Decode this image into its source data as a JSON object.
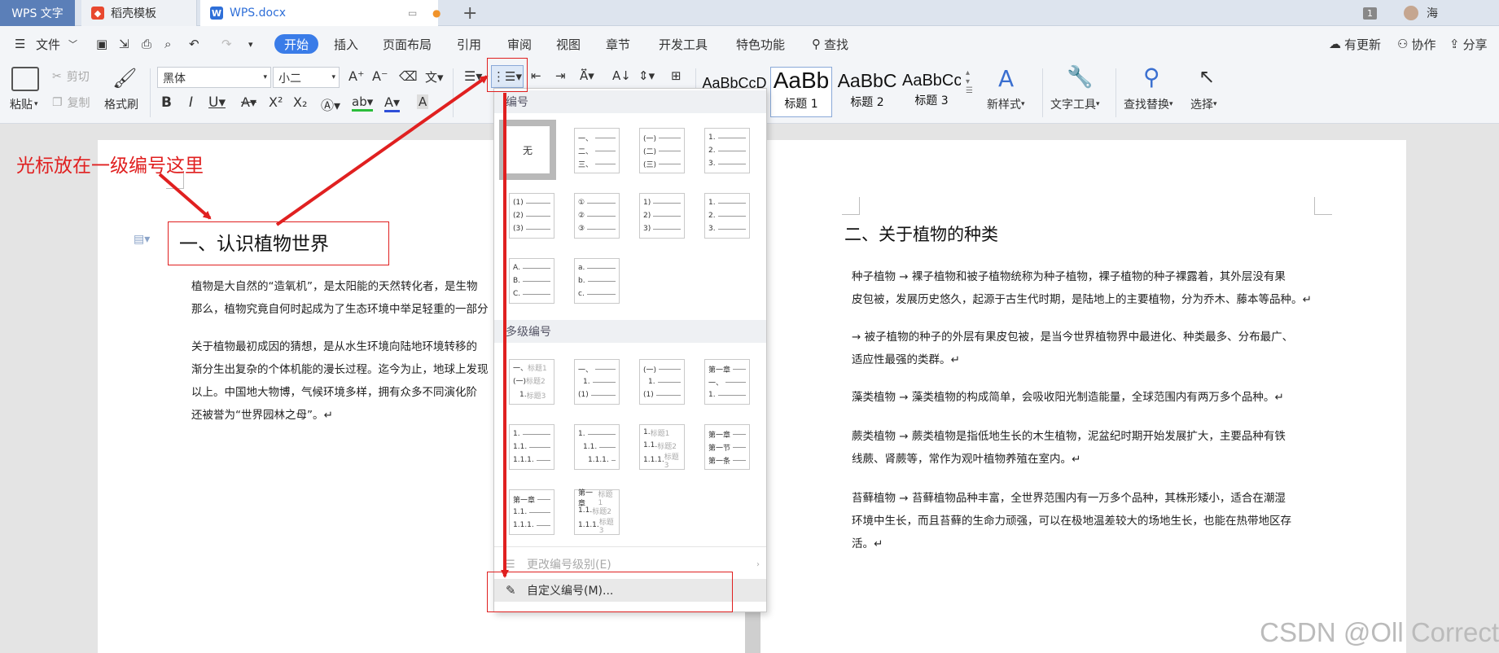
{
  "tabs": {
    "app": "WPS 文字",
    "template": "稻壳模板",
    "document": "WPS.docx",
    "page_badge": "1",
    "user": "海"
  },
  "menu": {
    "file": "文件",
    "items": [
      "开始",
      "插入",
      "页面布局",
      "引用",
      "审阅",
      "视图",
      "章节",
      "开发工具",
      "特色功能"
    ],
    "search": "查找",
    "update": "有更新",
    "collab": "协作",
    "share": "分享"
  },
  "ribbon": {
    "paste": "粘贴",
    "cut": "剪切",
    "copy": "复制",
    "format_painter": "格式刷",
    "font_name": "黑体",
    "font_size": "小二",
    "style_preview_normal": "AaBbCcD",
    "style_preview_h1": "AaBb",
    "style_preview_h2": "AaBbC",
    "style_preview_h3": "AaBbCc",
    "style_h1": "标题 1",
    "style_h2": "标题 2",
    "style_h3": "标题 3",
    "new_style": "新样式",
    "text_tools": "文字工具",
    "find_replace": "查找替换",
    "select": "选择"
  },
  "dropdown": {
    "numbering_title": "编号",
    "none_label": "无",
    "multilevel_title": "多级编号",
    "change_level": "更改编号级别(E)",
    "custom_numbering": "自定义编号(M)..."
  },
  "page1": {
    "heading": "一、认识植物世界",
    "p1_l1": "植物是大自然的“造氧机”，是太阳能的天然转化者，是生物",
    "p1_l2": "那么，植物究竟自何时起成为了生态环境中举足轻重的一部分",
    "p2_l1": "关于植物最初成因的猜想，是从水生环境向陆地环境转移的",
    "p2_l2": "渐分生出复杂的个体机能的漫长过程。迄今为止，地球上发现",
    "p2_l3": "以上。中国地大物博，气候环境多样，拥有众多不同演化阶",
    "p2_l4": "还被誉为“世界园林之母”。↵"
  },
  "page2": {
    "heading": "二、关于植物的种类",
    "s1_l1": "种子植物  →  裸子植物和被子植物统称为种子植物，裸子植物的种子裸露着，其外层没有果",
    "s1_l2": "皮包被，发展历史悠久，起源于古生代时期，是陆地上的主要植物，分为乔木、藤本等品种。↵",
    "s2_l1": "  →  被子植物的种子的外层有果皮包被，是当今世界植物界中最进化、种类最多、分布最广、",
    "s2_l2": "适应性最强的类群。↵",
    "s3_l1": "藻类植物  →  藻类植物的构成简单，会吸收阳光制造能量，全球范围内有两万多个品种。↵",
    "s4_l1": "蕨类植物  →  蕨类植物是指低地生长的木生植物，泥盆纪时期开始发展扩大，主要品种有铁",
    "s4_l2": "线蕨、肾蕨等，常作为观叶植物养殖在室内。↵",
    "s5_l1": "苔藓植物  →  苔藓植物品种丰富，全世界范围内有一万多个品种，其株形矮小，适合在潮湿",
    "s5_l2": "环境中生长，而且苔藓的生命力顽强，可以在极地温差较大的场地生长，也能在热带地区存",
    "s5_l3": "活。↵"
  },
  "annotation": {
    "text": "光标放在一级编号这里"
  },
  "watermark": "CSDN @Oll Correct",
  "colors": {
    "accent": "#3a7ce8",
    "annotation_red": "#e02020",
    "app_tab": "#5b7fb8"
  }
}
